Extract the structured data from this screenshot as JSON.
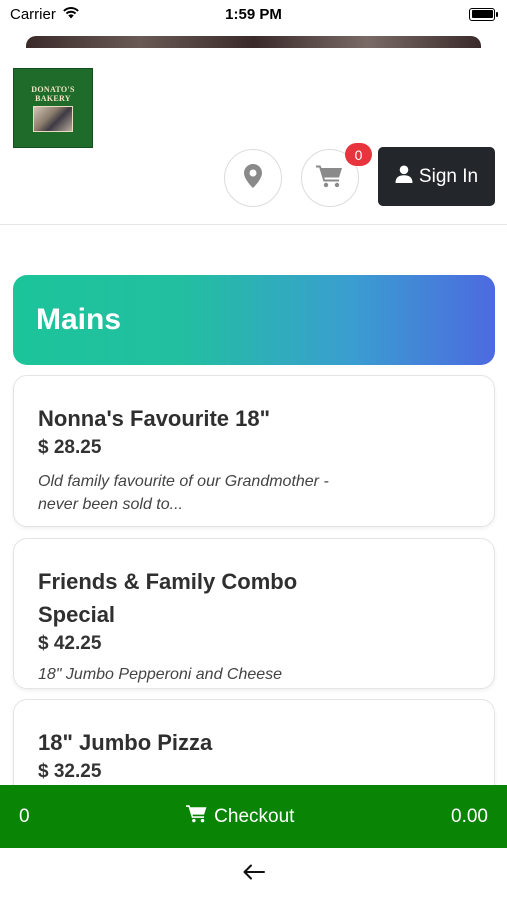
{
  "status_bar": {
    "carrier": "Carrier",
    "time": "1:59 PM"
  },
  "header": {
    "logo_text": "DONATO'S BAKERY",
    "cart_count": "0",
    "sign_in_label": "Sign In"
  },
  "category": {
    "title": "Mains"
  },
  "products": [
    {
      "name": "Nonna's Favourite 18\"",
      "price": "$ 28.25",
      "description": "Old family favourite of our Grandmother - never been sold to..."
    },
    {
      "name": "Friends & Family Combo Special",
      "price": "$ 42.25",
      "description": "18\" Jumbo Pepperoni and Cheese"
    },
    {
      "name": "18\" Jumbo Pizza",
      "price": "$ 32.25",
      "description": ""
    }
  ],
  "checkout_bar": {
    "item_count": "0",
    "label": "Checkout",
    "total": "0.00"
  },
  "colors": {
    "checkout_green": "#0a8405",
    "banner_start": "#1cc49a",
    "banner_end": "#4d6ae0",
    "badge_red": "#e8353d",
    "sign_in_dark": "#23272b"
  }
}
